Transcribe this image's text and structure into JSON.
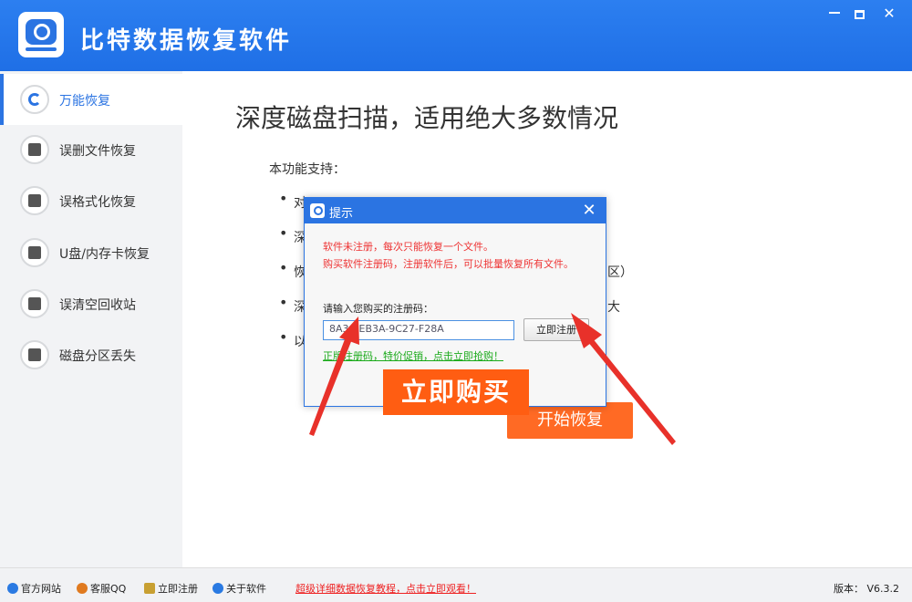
{
  "window": {
    "title": "比特数据恢复软件",
    "controls": {
      "minimize": "",
      "maximize": "",
      "close": "✕"
    }
  },
  "sidebar": {
    "items": [
      {
        "label": "万能恢复",
        "icon": "undo-icon",
        "active": true
      },
      {
        "label": "误删文件恢复",
        "icon": "folder-icon",
        "active": false
      },
      {
        "label": "误格式化恢复",
        "icon": "format-disk-icon",
        "active": false
      },
      {
        "label": "U盘/内存卡恢复",
        "icon": "usb-drive-icon",
        "active": false
      },
      {
        "label": "误清空回收站",
        "icon": "trash-icon",
        "active": false
      },
      {
        "label": "磁盘分区丢失",
        "icon": "disk-partition-icon",
        "active": false
      }
    ]
  },
  "main": {
    "heading": "深度磁盘扫描，适用绝大多数情况",
    "support_label": "本功能支持：",
    "bullets": [
      {
        "text": "对",
        "suffix": ""
      },
      {
        "text": "深",
        "suffix": ""
      },
      {
        "text": "恢",
        "suffix": "区）"
      },
      {
        "text": "深",
        "suffix": "大"
      },
      {
        "text": "以",
        "suffix": ""
      }
    ],
    "start_button": "开始恢复"
  },
  "dialog": {
    "title": "提示",
    "close": "✕",
    "notice_line1": "软件未注册，每次只能恢复一个文件。",
    "notice_line2": "购买软件注册码，注册软件后，可以批量恢复所有文件。",
    "prompt": "请输入您购买的注册码：",
    "code_value": "8A34-EB3A-9C27-F28A",
    "register_button": "立即注册",
    "promo_link": "正版注册码，特价促销，点击立即抢购！",
    "buy_button": "立即购买"
  },
  "statusbar": {
    "items": [
      {
        "label": "官方网站",
        "icon": "ie-icon",
        "color": "#2a7ae2"
      },
      {
        "label": "客服QQ",
        "icon": "qq-icon",
        "color": "#e07a1f"
      },
      {
        "label": "立即注册",
        "icon": "pencil-icon",
        "color": "#c8a032"
      },
      {
        "label": "关于软件",
        "icon": "info-icon",
        "color": "#2a7ae2"
      }
    ],
    "tutorial_link": "超级详细数据恢复教程，点击立即观看！",
    "version": "版本： V6.3.2"
  },
  "colors": {
    "brand_blue": "#2b74e2",
    "start_orange": "#ff6a24",
    "buy_orange": "#ff5d12",
    "warning_red": "#e33333",
    "arrow_red": "#e8312a"
  }
}
